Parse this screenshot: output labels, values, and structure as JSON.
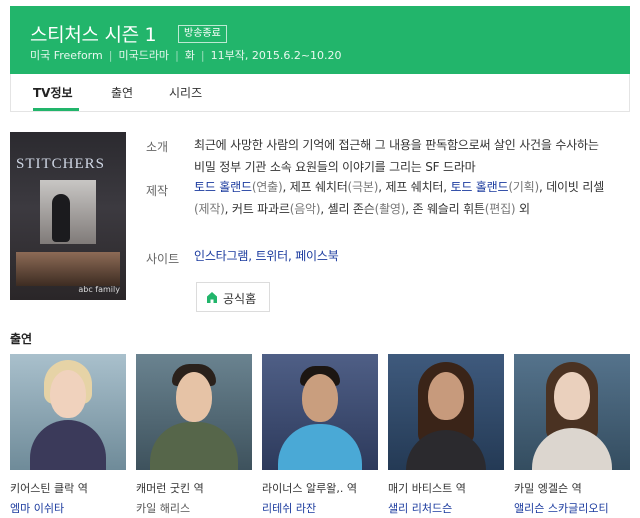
{
  "header": {
    "title": "스티처스 시즌 1",
    "badge": "방송종료",
    "meta": [
      "미국 Freeform",
      "미국드라마",
      "화",
      "11부작, 2015.6.2~10.20"
    ]
  },
  "tabs": [
    {
      "label": "TV정보",
      "active": true
    },
    {
      "label": "출연",
      "active": false
    },
    {
      "label": "시리즈",
      "active": false
    }
  ],
  "poster": {
    "title": "STITCHERS",
    "network": "abc family"
  },
  "info": {
    "synopsis_label": "소개",
    "synopsis": "최근에 사망한 사람의 기억에 접근해 그 내용을 판독함으로써 살인 사건을 수사하는 비밀 정부 기관 소속 요원들의 이야기를 그리는 SF 드라마",
    "production_label": "제작",
    "production": [
      {
        "name": "토드 홀랜드",
        "role": "(연출)",
        "link": true
      },
      {
        "name": "제프 쉐치터",
        "role": "(극본)",
        "link": false
      },
      {
        "name": "제프 쉐치터",
        "role": "",
        "link": false
      },
      {
        "name": "토드 홀랜드",
        "role": "(기획)",
        "link": true
      },
      {
        "name": "데이빗 리셀",
        "role": "(제작)",
        "link": false
      },
      {
        "name": "커트 파과르",
        "role": "(음악)",
        "link": false
      },
      {
        "name": "셸리 존슨",
        "role": "(촬영)",
        "link": false
      },
      {
        "name": "존 웨슬리 휘튼",
        "role": "(편집)",
        "link": false
      }
    ],
    "production_more": "외",
    "site_label": "사이트",
    "sites": [
      "인스타그램",
      "트위터",
      "페이스북"
    ],
    "home_button": "공식홈"
  },
  "cast_title": "출연",
  "cast": [
    {
      "role": "키어스틴 클락 역",
      "name": "엠마 이쉬타",
      "linked": true
    },
    {
      "role": "캐머런 굿킨 역",
      "name": "카일 해리스",
      "linked": false
    },
    {
      "role": "라이너스 알루왈,. 역",
      "name": "리테쉬 라잔",
      "linked": true
    },
    {
      "role": "매기 바티스트 역",
      "name": "샐리 리처드슨",
      "linked": true
    },
    {
      "role": "카밀 엥겔슨 역",
      "name": "앨리슨 스카글리오티",
      "linked": true
    }
  ],
  "colors": {
    "accent": "#22b56b",
    "link": "#1a3a9e"
  }
}
